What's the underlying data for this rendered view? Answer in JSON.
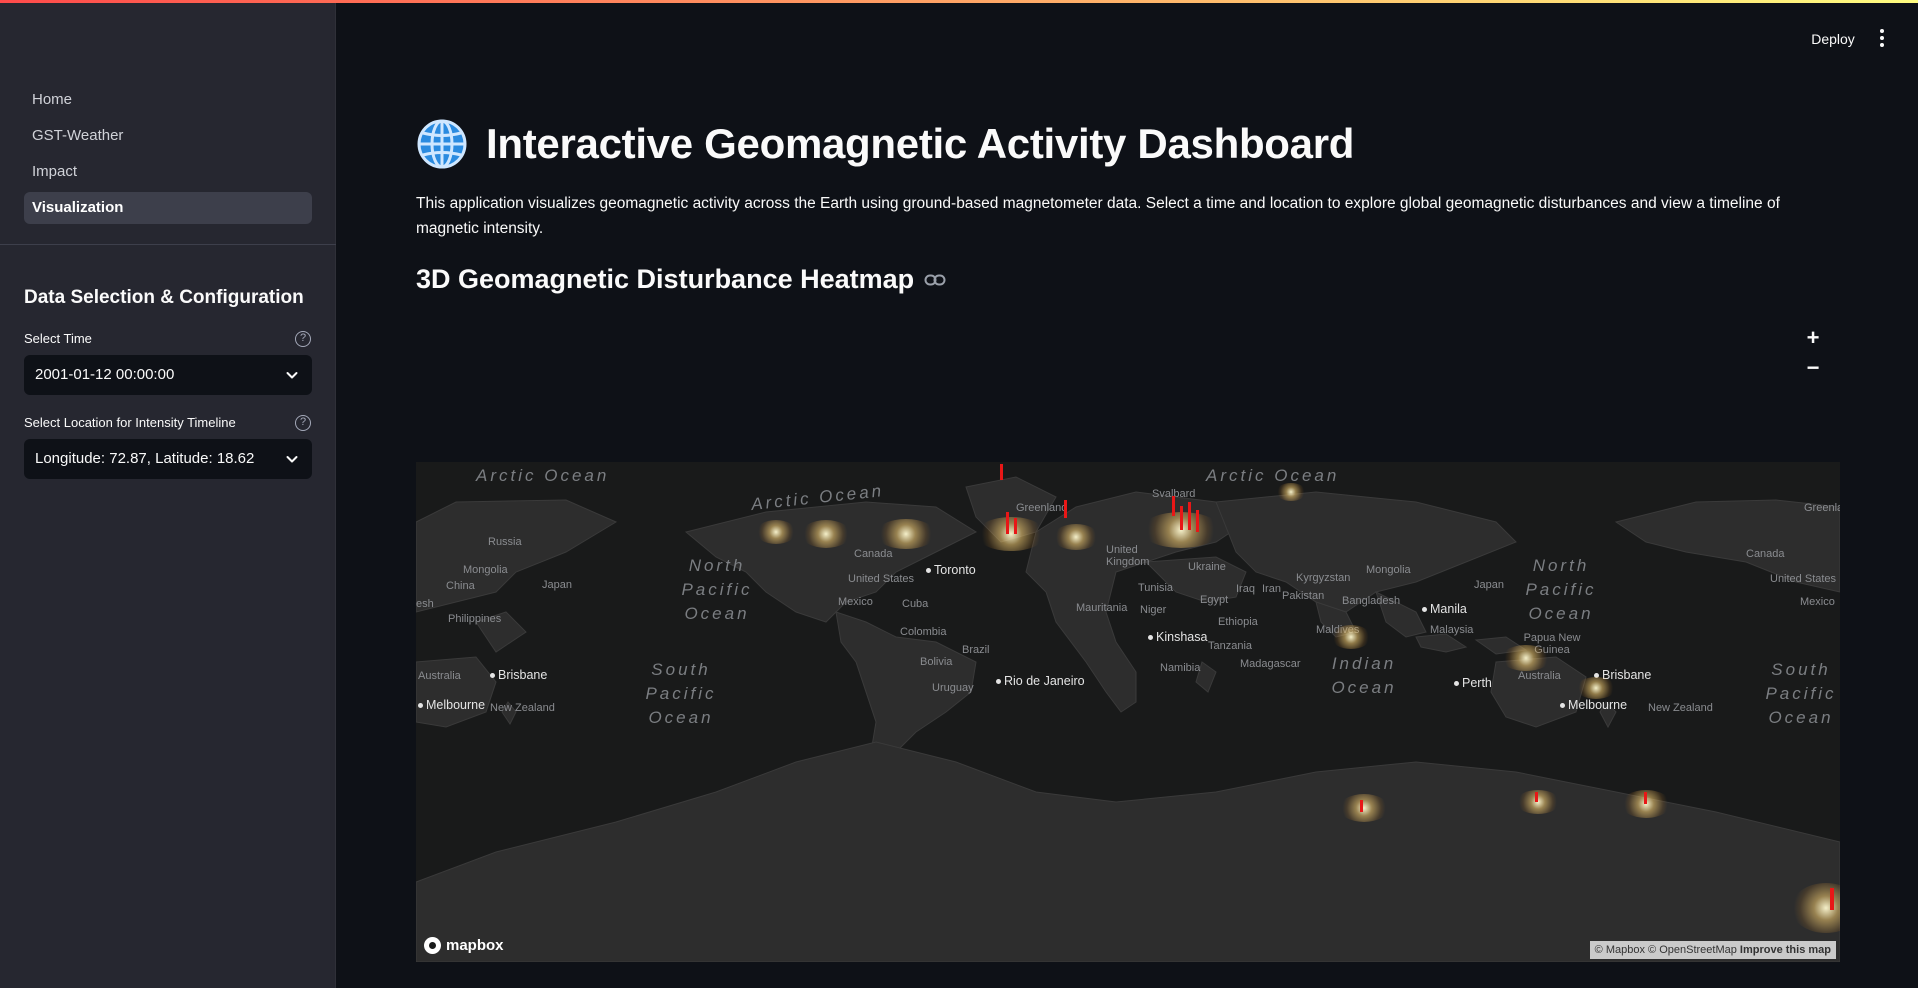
{
  "sidebar": {
    "nav": [
      {
        "label": "Home",
        "active": false
      },
      {
        "label": "GST-Weather",
        "active": false
      },
      {
        "label": "Impact",
        "active": false
      },
      {
        "label": "Visualization",
        "active": true
      }
    ],
    "section_title": "Data Selection & Configuration",
    "time": {
      "label": "Select Time",
      "value": "2001-01-12 00:00:00"
    },
    "location": {
      "label": "Select Location for Intensity Timeline",
      "value": "Longitude: 72.87, Latitude: 18.62"
    }
  },
  "header": {
    "deploy_label": "Deploy"
  },
  "main": {
    "title": "Interactive Geomagnetic Activity Dashboard",
    "intro": "This application visualizes geomagnetic activity across the Earth using ground-based magnetometer data. Select a time and location to explore global geomagnetic disturbances and view a timeline of magnetic intensity.",
    "subtitle": "3D Geomagnetic Disturbance Heatmap"
  },
  "map": {
    "zoom_in": "+",
    "zoom_out": "−",
    "oceans": {
      "arctic1": "Arctic Ocean",
      "arctic2": "Arctic Ocean",
      "arctic3": "Arctic Ocean",
      "north_pacific1": "North Pacific Ocean",
      "north_pacific2": "North Pacific Ocean",
      "south_pacific1": "South Pacific Ocean",
      "south_pacific2": "South Pacific Ocean",
      "indian": "Indian Ocean"
    },
    "places": {
      "russia": "Russia",
      "mongolia1": "Mongolia",
      "china": "China",
      "japan1": "Japan",
      "philippines": "Philippines",
      "australia1": "Australia",
      "new_zealand1": "New Zealand",
      "canada1": "Canada",
      "united_states1": "United States",
      "mexico1": "Mexico",
      "cuba": "Cuba",
      "colombia": "Colombia",
      "brazil": "Brazil",
      "bolivia": "Bolivia",
      "uruguay": "Uruguay",
      "greenland1": "Greenland",
      "svalbard": "Svalbard",
      "united_kingdom": "United Kingdom",
      "ukraine": "Ukraine",
      "kyrgyzstan": "Kyrgyzstan",
      "mongolia2": "Mongolia",
      "japan2": "Japan",
      "tunisia": "Tunisia",
      "iraq": "Iraq",
      "iran": "Iran",
      "pakistan": "Pakistan",
      "bangladesh": "Bangladesh",
      "mauritania": "Mauritania",
      "niger": "Niger",
      "egypt": "Egypt",
      "ethiopia": "Ethiopia",
      "tanzania": "Tanzania",
      "namibia": "Namibia",
      "madagascar": "Madagascar",
      "maldives": "Maldives",
      "malaysia": "Malaysia",
      "papua": "Papua New Guinea",
      "australia2": "Australia",
      "new_zealand2": "New Zealand",
      "canada2": "Canada",
      "united_states2": "United States",
      "mexico2": "Mexico",
      "greenland2": "Greenland",
      "esh": "esh"
    },
    "cities": {
      "brisbane1": "Brisbane",
      "melbourne1": "Melbourne",
      "toronto": "Toronto",
      "rio": "Rio de Janeiro",
      "kinshasa": "Kinshasa",
      "manila": "Manila",
      "perth": "Perth",
      "brisbane2": "Brisbane",
      "melbourne2": "Melbourne"
    },
    "logo": "mapbox",
    "attribution": {
      "mapbox": "© Mapbox",
      "osm": "© OpenStreetMap",
      "improve": "Improve this map"
    }
  }
}
